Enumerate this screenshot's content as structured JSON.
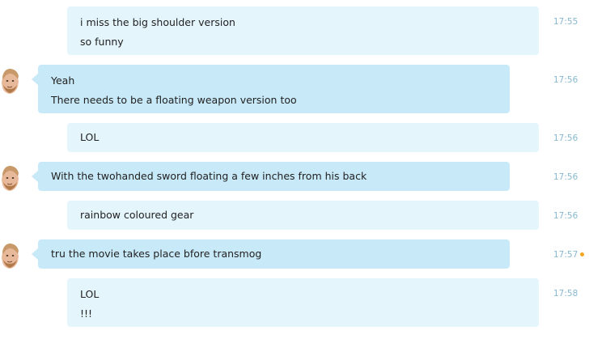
{
  "colors": {
    "mine_bubble": "#e4f5fc",
    "their_bubble": "#c8e9f8",
    "timestamp": "#86b9cf",
    "unread_dot": "#f5a623"
  },
  "messages": [
    {
      "sender": "me",
      "lines": [
        "i miss the big shoulder version",
        "so funny"
      ],
      "time": "17:55"
    },
    {
      "sender": "contact",
      "avatar": "bearded-man-avatar",
      "lines": [
        "Yeah",
        "There needs to be a floating weapon version too"
      ],
      "time": "17:56"
    },
    {
      "sender": "me",
      "lines": [
        "LOL"
      ],
      "time": "17:56"
    },
    {
      "sender": "contact",
      "avatar": "bearded-man-avatar",
      "lines": [
        "With the twohanded sword floating a few inches from his back"
      ],
      "time": "17:56"
    },
    {
      "sender": "me",
      "lines": [
        "rainbow coloured gear"
      ],
      "time": "17:56"
    },
    {
      "sender": "contact",
      "avatar": "bearded-man-avatar",
      "lines": [
        "tru the movie takes place bfore transmog"
      ],
      "time": "17:57",
      "status_icon": "unread-dot-icon"
    },
    {
      "sender": "me",
      "lines": [
        "LOL",
        "!!!"
      ],
      "time": "17:58"
    }
  ]
}
